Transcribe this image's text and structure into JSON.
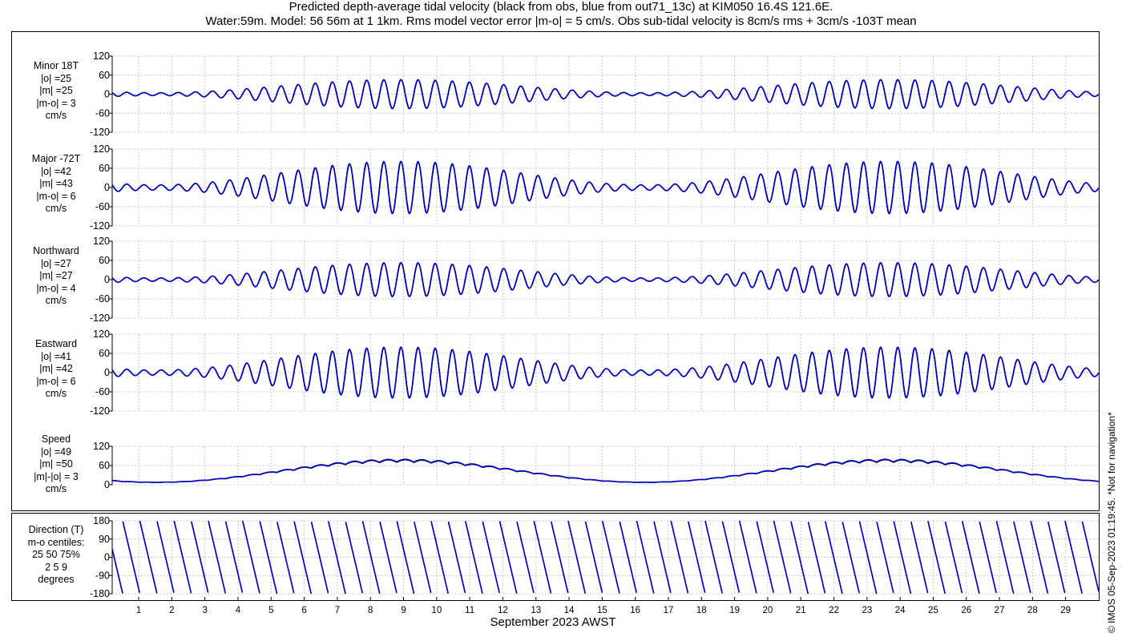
{
  "title": {
    "line1": "Predicted depth-average tidal velocity (black from obs, blue from out71_13c) at KIM050 16.4S 121.6E.",
    "line2": "Water:59m. Model: 56 56m at 1 1km. Rms model vector error |m-o| = 5 cm/s. Obs sub-tidal velocity is 8cm/s rms + 3cm/s -103T mean"
  },
  "credit": "© IMOS 05-Sep-2023 01:19:45. *Not for navigation*",
  "colors": {
    "obs": "#000000",
    "model": "#0000cc",
    "grid": "#c8c8c8"
  },
  "chart_data": {
    "type": "line",
    "xlabel": "September 2023 AWST",
    "x_ticks": [
      1,
      2,
      3,
      4,
      5,
      6,
      7,
      8,
      9,
      10,
      11,
      12,
      13,
      14,
      15,
      16,
      17,
      18,
      19,
      20,
      21,
      22,
      23,
      24,
      25,
      26,
      27,
      28,
      29
    ],
    "x_range": [
      0.2,
      30.0
    ],
    "grid": true,
    "series_names": [
      "obs",
      "model"
    ],
    "panels": [
      {
        "id": "minor",
        "label_lines": [
          "Minor 18T",
          "|o| =25",
          "|m| =25",
          "|m-o| = 3",
          "cm/s"
        ],
        "ylim": [
          -120,
          120
        ],
        "yticks": [
          -120,
          -60,
          0,
          60,
          120
        ],
        "amplitude": 45
      },
      {
        "id": "major",
        "label_lines": [
          "Major -72T",
          "|o| =42",
          "|m| =43",
          "|m-o| = 6",
          "cm/s"
        ],
        "ylim": [
          -120,
          120
        ],
        "yticks": [
          -120,
          -60,
          0,
          60,
          120
        ],
        "amplitude": 80
      },
      {
        "id": "north",
        "label_lines": [
          "Northward",
          "|o| =27",
          "|m| =27",
          "|m-o| = 4",
          "cm/s"
        ],
        "ylim": [
          -120,
          120
        ],
        "yticks": [
          -120,
          -60,
          0,
          60,
          120
        ],
        "amplitude": 52
      },
      {
        "id": "east",
        "label_lines": [
          "Eastward",
          "|o| =41",
          "|m| =42",
          "|m-o| = 6",
          "cm/s"
        ],
        "ylim": [
          -120,
          120
        ],
        "yticks": [
          -120,
          -60,
          0,
          60,
          120
        ],
        "amplitude": 78
      },
      {
        "id": "speed",
        "label_lines": [
          "Speed",
          "|o| =49",
          "|m| =50",
          "|m|-|o| = 3",
          "cm/s"
        ],
        "ylim": [
          0,
          120
        ],
        "yticks": [
          0,
          60,
          120
        ],
        "amplitude": 70
      },
      {
        "id": "direction",
        "label_lines": [
          "Direction (T)",
          "m-o centiles:",
          "25  50  75%",
          "2   5   9",
          "degrees"
        ],
        "ylim": [
          -180,
          180
        ],
        "yticks": [
          -180,
          -90,
          0,
          90,
          180
        ]
      }
    ]
  }
}
